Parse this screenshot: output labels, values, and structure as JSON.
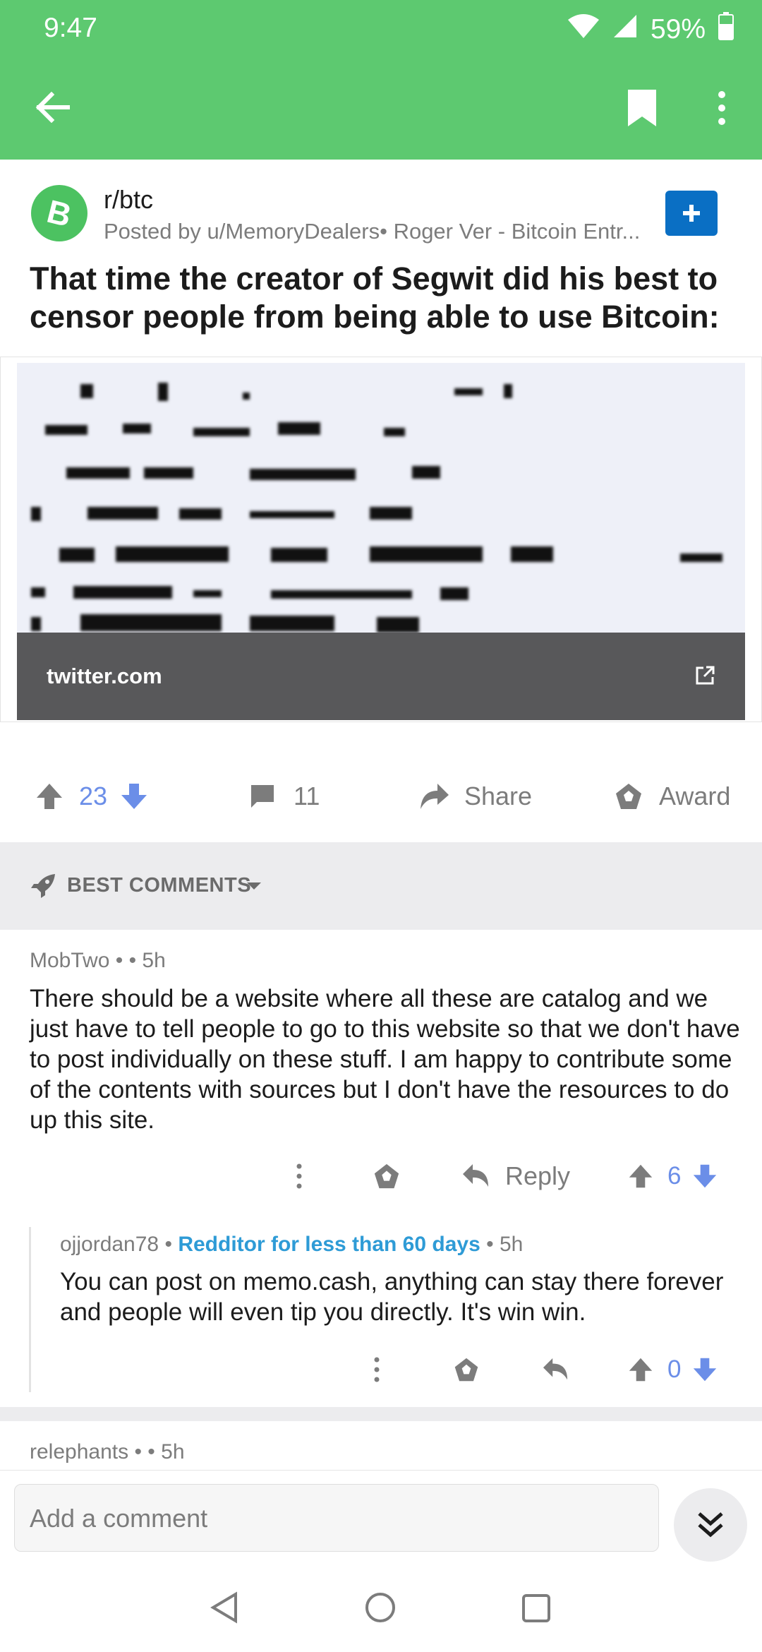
{
  "status_bar": {
    "time": "9:47",
    "battery": "59%"
  },
  "post": {
    "subreddit": "r/btc",
    "posted_by": "Posted by u/MemoryDealers• Roger Ver - Bitcoin Entr...",
    "title": "That time the creator of Segwit did his best to censor people from being able to use Bitcoin:",
    "link_domain": "twitter.com",
    "score": "23",
    "comments": "11",
    "share_label": "Share",
    "award_label": "Award"
  },
  "sort": {
    "label": "BEST COMMENTS"
  },
  "comments": [
    {
      "author": "MobTwo",
      "time": "5h",
      "body": "There should be a website where all these are catalog and we just have to tell people to go to this website so that we don't have to post individually on these stuff. I am happy to contribute some of the contents with sources but I don't have the resources to do up this site.",
      "reply_label": "Reply",
      "score": "6"
    },
    {
      "author": "ojjordan78",
      "flair": "Redditor for less than 60 days",
      "time": "5h",
      "body": "You can post on memo.cash, anything can stay there forever and people will even tip you directly. It's win win.",
      "score": "0"
    },
    {
      "author": "relephants",
      "time": "5h"
    }
  ],
  "composer": {
    "placeholder": "Add a comment"
  },
  "colors": {
    "app_bar": "#5dc970",
    "join_button": "#0a6fc4",
    "vote": "#6b8ee8",
    "flair": "#2e9bd6"
  }
}
